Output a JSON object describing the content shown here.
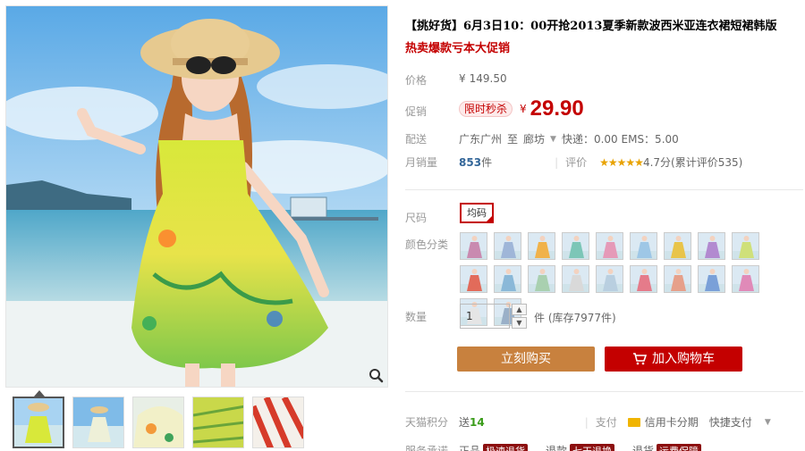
{
  "title": "【挑好货】6月3日10：00开抢2013夏季新款波西米亚连衣裙短裙韩版",
  "subtitle": "热卖爆款亏本大促销",
  "price": {
    "label": "价格",
    "currency": "¥",
    "original": "149.50"
  },
  "promo": {
    "label": "促销",
    "tag": "限时秒杀",
    "currency": "¥",
    "value": "29.90"
  },
  "shipping": {
    "label": "配送",
    "from": "广东广州",
    "to_word": "至",
    "destination": "廊坊",
    "fee": "快递：0.00 EMS：5.00"
  },
  "sales": {
    "label": "月销量",
    "count": "853",
    "unit": "件",
    "rating_label": "评价",
    "stars": "★★★★★",
    "rating_text": "4.7分(累计评价535)"
  },
  "size": {
    "label": "尺码",
    "option": "均码"
  },
  "color": {
    "label": "颜色分类",
    "swatch_count": 20
  },
  "quantity": {
    "label": "数量",
    "value": "1",
    "stock": "件 (库存7977件)"
  },
  "buttons": {
    "buy": "立刻购买",
    "cart": "加入购物车"
  },
  "points": {
    "label": "天猫积分",
    "text": "送",
    "value": "14"
  },
  "payment": {
    "label": "支付",
    "credit": "信用卡分期",
    "quick": "快捷支付"
  },
  "services": {
    "label": "服务承诺",
    "item1": "正品",
    "tag1": "极速退货",
    "item2": "退款",
    "tag2": "七天退换",
    "item3": "退货",
    "tag3": "运费保障"
  },
  "colors": {
    "accent": "#c40000",
    "buy": "#c8813e"
  }
}
